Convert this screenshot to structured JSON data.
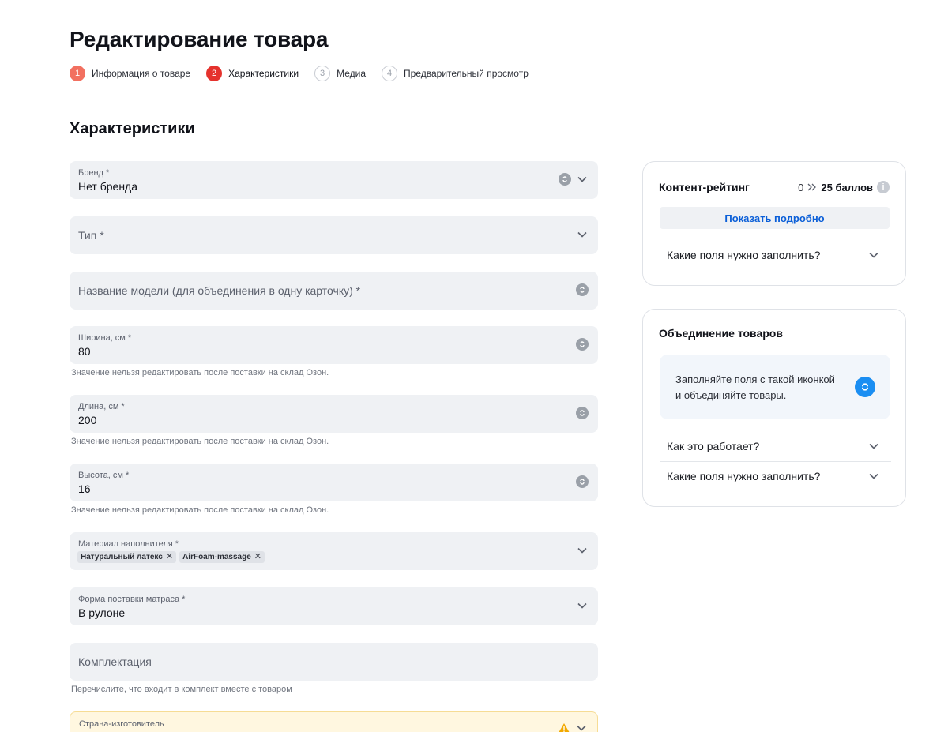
{
  "page": {
    "title": "Редактирование товара"
  },
  "steps": [
    {
      "num": "1",
      "label": "Информация о товаре",
      "state": "done"
    },
    {
      "num": "2",
      "label": "Характеристики",
      "state": "active"
    },
    {
      "num": "3",
      "label": "Медиа",
      "state": "todo"
    },
    {
      "num": "4",
      "label": "Предварительный просмотр",
      "state": "todo"
    }
  ],
  "section": {
    "title": "Характеристики"
  },
  "fields": {
    "brand": {
      "label": "Бренд *",
      "value": "Нет бренда"
    },
    "type": {
      "placeholder": "Тип *"
    },
    "model": {
      "placeholder": "Название модели (для объединения в одну карточку) *"
    },
    "width": {
      "label": "Ширина, см *",
      "value": "80",
      "hint": "Значение нельзя редактировать после поставки на склад Озон."
    },
    "length": {
      "label": "Длина, см *",
      "value": "200",
      "hint": "Значение нельзя редактировать после поставки на склад Озон."
    },
    "height": {
      "label": "Высота, см *",
      "value": "16",
      "hint": "Значение нельзя редактировать после поставки на склад Озон."
    },
    "filler": {
      "label": "Материал наполнителя *",
      "chips": [
        "Натуральный латекс",
        "AirFoam-massage"
      ]
    },
    "delivery_form": {
      "label": "Форма поставки матраса *",
      "value": "В рулоне"
    },
    "package": {
      "placeholder": "Комплектация",
      "hint": "Перечислите, что входит в комплект вместе с товаром"
    },
    "country": {
      "label": "Страна-изготовитель"
    }
  },
  "rating_card": {
    "title": "Контент-рейтинг",
    "from": "0",
    "to": "25 баллов",
    "button": "Показать подробно",
    "accordion": "Какие поля нужно заполнить?"
  },
  "merge_card": {
    "title": "Объединение товаров",
    "info_line1": "Заполняйте поля с такой иконкой",
    "info_line2": "и объединяйте товары.",
    "accordion1": "Как это работает?",
    "accordion2": "Какие поля нужно заполнить?"
  },
  "colors": {
    "step_done": "#f27060",
    "step_active": "#e5322d",
    "link_blue": "#0b5fd8",
    "merge_blue": "#1b8ef2",
    "field_bg": "#eff1f4"
  }
}
